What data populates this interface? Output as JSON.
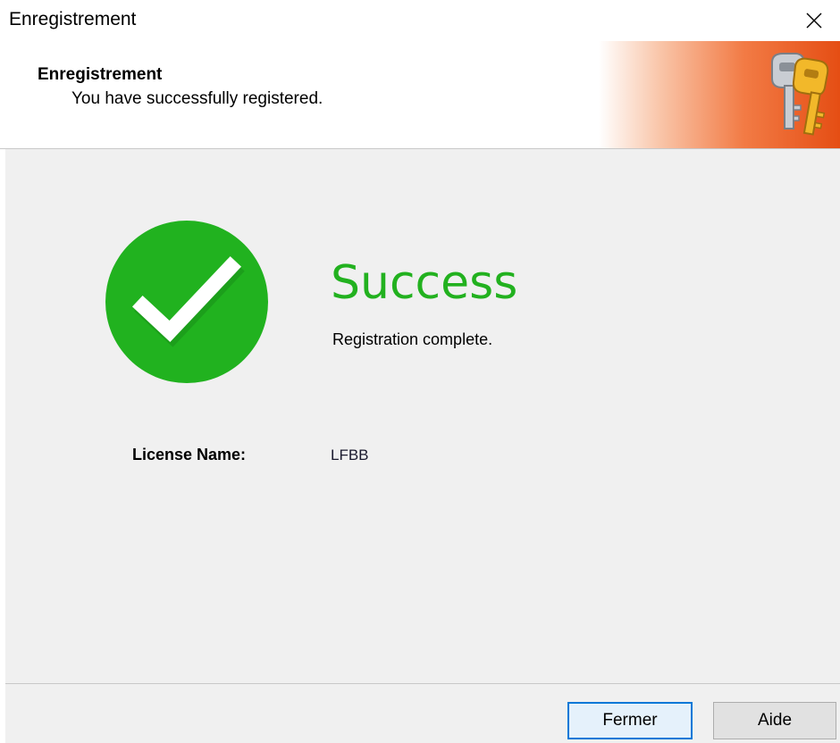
{
  "window": {
    "title": "Enregistrement"
  },
  "header": {
    "title": "Enregistrement",
    "subtitle": "You have successfully registered."
  },
  "main": {
    "status_title": "Success",
    "status_message": "Registration complete.",
    "license_label": "License Name:",
    "license_value": "LFBB"
  },
  "footer": {
    "close_label": "Fermer",
    "help_label": "Aide"
  },
  "colors": {
    "success_green": "#22b11f",
    "banner_orange": "#e54e14",
    "focus_blue": "#0078d7"
  },
  "icons": {
    "close": "close-icon",
    "keys": "keys-icon",
    "success": "checkmark-circle-icon"
  }
}
